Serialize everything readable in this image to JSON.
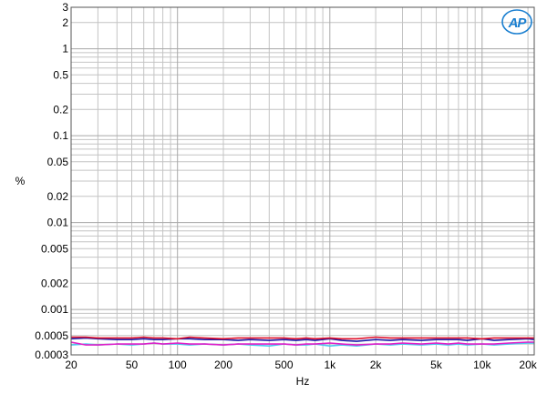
{
  "chart_data": {
    "type": "line",
    "title": "",
    "xlabel": "Hz",
    "ylabel": "%",
    "x_scale": "log",
    "y_scale": "log",
    "xlim": [
      20,
      22000
    ],
    "ylim": [
      0.0003,
      3
    ],
    "grid": true,
    "legend": "none",
    "logo_text": "AP",
    "x_ticks": [
      {
        "value": 20,
        "label": "20"
      },
      {
        "value": 50,
        "label": "50"
      },
      {
        "value": 100,
        "label": "100"
      },
      {
        "value": 200,
        "label": "200"
      },
      {
        "value": 500,
        "label": "500"
      },
      {
        "value": 1000,
        "label": "1k"
      },
      {
        "value": 2000,
        "label": "2k"
      },
      {
        "value": 5000,
        "label": "5k"
      },
      {
        "value": 10000,
        "label": "10k"
      },
      {
        "value": 20000,
        "label": "20k"
      }
    ],
    "y_ticks": [
      {
        "value": 3,
        "label": "3"
      },
      {
        "value": 2,
        "label": "2"
      },
      {
        "value": 1,
        "label": "1"
      },
      {
        "value": 0.5,
        "label": "0.5"
      },
      {
        "value": 0.2,
        "label": "0.2"
      },
      {
        "value": 0.1,
        "label": "0.1"
      },
      {
        "value": 0.05,
        "label": "0.05"
      },
      {
        "value": 0.02,
        "label": "0.02"
      },
      {
        "value": 0.01,
        "label": "0.01"
      },
      {
        "value": 0.005,
        "label": "0.005"
      },
      {
        "value": 0.002,
        "label": "0.002"
      },
      {
        "value": 0.001,
        "label": "0.001"
      },
      {
        "value": 0.0005,
        "label": "0.0005"
      },
      {
        "value": 0.0003,
        "label": "0.0003"
      }
    ],
    "x": [
      20,
      25,
      30,
      40,
      50,
      60,
      70,
      80,
      100,
      120,
      150,
      200,
      250,
      300,
      400,
      500,
      600,
      700,
      800,
      1000,
      1200,
      1500,
      2000,
      2500,
      3000,
      4000,
      5000,
      6000,
      7000,
      8000,
      10000,
      12000,
      15000,
      20000,
      22000
    ],
    "series": [
      {
        "color": "#1a1aa8",
        "values": [
          0.00046,
          0.00047,
          0.00046,
          0.00045,
          0.00045,
          0.00046,
          0.00045,
          0.00045,
          0.00046,
          0.00046,
          0.00045,
          0.00045,
          0.00044,
          0.00045,
          0.00044,
          0.00045,
          0.00044,
          0.00045,
          0.00044,
          0.00046,
          0.00044,
          0.00043,
          0.00045,
          0.00044,
          0.00045,
          0.00044,
          0.00045,
          0.00045,
          0.00045,
          0.00044,
          0.00046,
          0.00044,
          0.00045,
          0.00046,
          0.00045
        ]
      },
      {
        "color": "#e0102a",
        "values": [
          0.00048,
          0.00048,
          0.00047,
          0.00047,
          0.00047,
          0.00048,
          0.00047,
          0.00047,
          0.00046,
          0.00048,
          0.00047,
          0.00046,
          0.00047,
          0.00047,
          0.00047,
          0.00047,
          0.00046,
          0.00047,
          0.00046,
          0.00047,
          0.00046,
          0.00046,
          0.00048,
          0.00047,
          0.00047,
          0.00047,
          0.00047,
          0.00047,
          0.00047,
          0.00047,
          0.00046,
          0.00047,
          0.00047,
          0.00047,
          0.00047
        ]
      },
      {
        "color": "#4ec8ee",
        "values": [
          0.00039,
          0.0004,
          0.00039,
          0.0004,
          0.00039,
          0.0004,
          0.00041,
          0.0004,
          0.0004,
          0.00039,
          0.0004,
          0.00039,
          0.0004,
          0.00039,
          0.00038,
          0.0004,
          0.00039,
          0.00039,
          0.0004,
          0.00038,
          0.00039,
          0.00038,
          0.0004,
          0.00039,
          0.0004,
          0.00039,
          0.0004,
          0.00039,
          0.0004,
          0.00039,
          0.0004,
          0.00039,
          0.0004,
          0.00041,
          0.00041
        ]
      },
      {
        "color": "#e020c8",
        "values": [
          0.00042,
          0.00039,
          0.00039,
          0.0004,
          0.0004,
          0.0004,
          0.00041,
          0.0004,
          0.00041,
          0.0004,
          0.0004,
          0.00039,
          0.0004,
          0.0004,
          0.0004,
          0.0004,
          0.00039,
          0.0004,
          0.0004,
          0.00041,
          0.0004,
          0.00039,
          0.0004,
          0.0004,
          0.00041,
          0.0004,
          0.00041,
          0.0004,
          0.00041,
          0.0004,
          0.0004,
          0.0004,
          0.00041,
          0.00042,
          0.00042
        ]
      }
    ]
  }
}
